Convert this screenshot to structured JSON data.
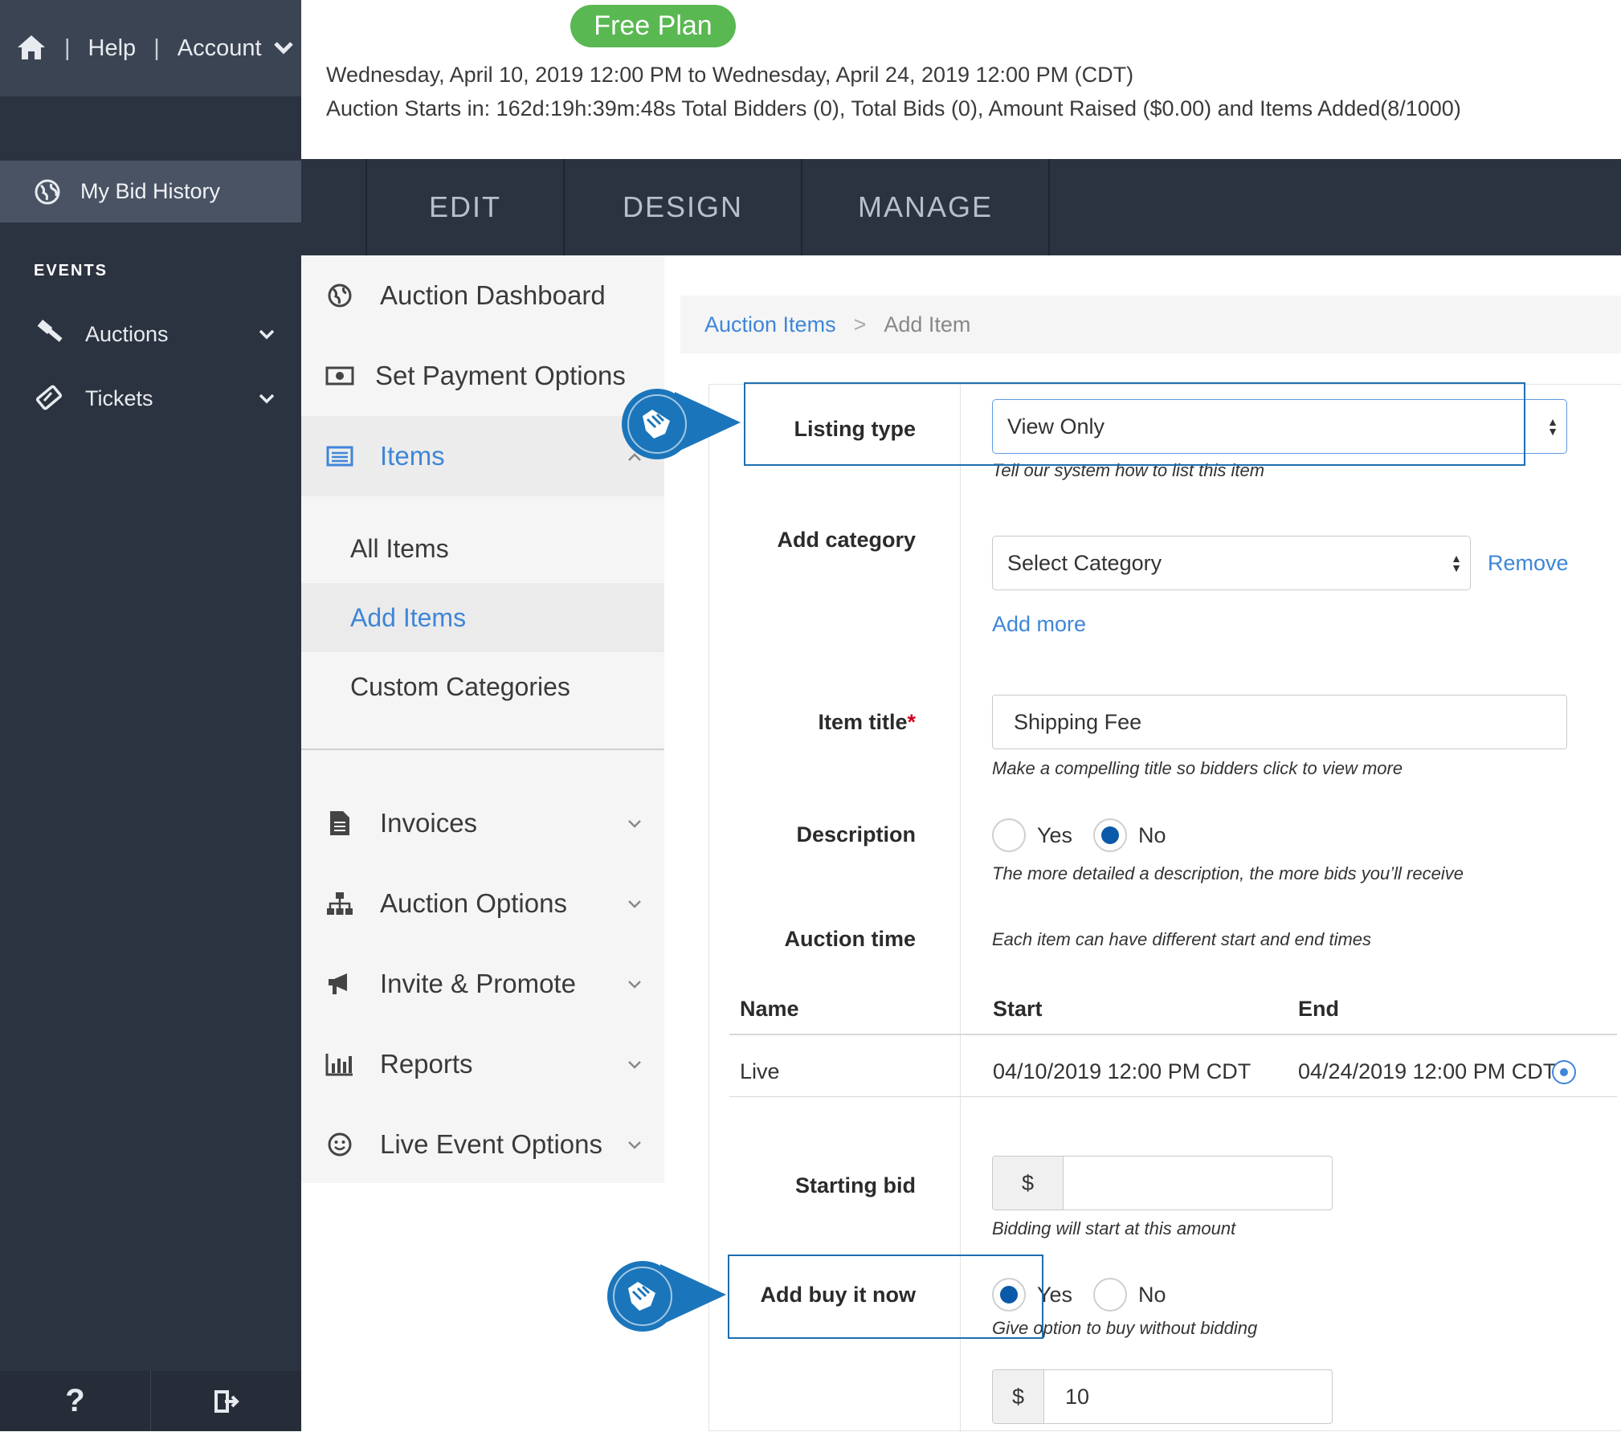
{
  "sidebar": {
    "top": {
      "help": "Help",
      "account": "Account"
    },
    "bid_history": "My Bid History",
    "events_label": "EVENTS",
    "items": [
      {
        "label": "Auctions",
        "icon": "gavel-icon"
      },
      {
        "label": "Tickets",
        "icon": "ticket-icon"
      }
    ],
    "bottom": {
      "help_symbol": "?"
    }
  },
  "header": {
    "plan_badge": "Free Plan",
    "dates": "Wednesday, April 10, 2019 12:00 PM to Wednesday, April 24, 2019 12:00 PM (CDT)",
    "stats": "Auction Starts in: 162d:19h:39m:48s Total Bidders (0), Total Bids (0), Amount Raised ($0.00) and Items Added(8/1000)"
  },
  "tabs": [
    "EDIT",
    "DESIGN",
    "MANAGE"
  ],
  "subnav": {
    "dashboard": "Auction Dashboard",
    "payment": "Set Payment Options",
    "items": "Items",
    "all_items": "All Items",
    "add_items": "Add Items",
    "custom_categories": "Custom Categories",
    "invoices": "Invoices",
    "auction_options": "Auction Options",
    "invite": "Invite & Promote",
    "reports": "Reports",
    "live_event": "Live Event Options"
  },
  "breadcrumb": {
    "parent": "Auction Items",
    "separator": ">",
    "current": "Add Item"
  },
  "form": {
    "listing_type": {
      "label": "Listing type",
      "value": "View Only",
      "hint": "Tell our system how to list this item"
    },
    "category": {
      "label": "Add category",
      "value": "Select Category",
      "remove": "Remove",
      "add_more": "Add more"
    },
    "title": {
      "label": "Item title",
      "required": "*",
      "value": "Shipping Fee",
      "hint": "Make a compelling title so bidders click to view more"
    },
    "description": {
      "label": "Description",
      "yes": "Yes",
      "no": "No",
      "selected": "No",
      "hint": "The more detailed a description, the more bids you’ll receive"
    },
    "auction_time": {
      "label": "Auction time",
      "hint": "Each item can have different start and end times",
      "headers": [
        "Name",
        "Start",
        "End"
      ],
      "rows": [
        {
          "name": "Live",
          "start": "04/10/2019 12:00 PM CDT",
          "end": "04/24/2019 12:00 PM CDT"
        }
      ]
    },
    "starting_bid": {
      "label": "Starting bid",
      "currency": "$",
      "value": "",
      "hint": "Bidding will start at this amount"
    },
    "buy_now": {
      "label": "Add buy it now",
      "yes": "Yes",
      "no": "No",
      "selected": "Yes",
      "hint": "Give option to buy without bidding",
      "currency": "$",
      "value": "10"
    }
  },
  "colors": {
    "sidebar": "#2c3340",
    "accent_blue": "#3e86d8",
    "badge_green": "#59b851",
    "callout_blue": "#1b75bb"
  }
}
